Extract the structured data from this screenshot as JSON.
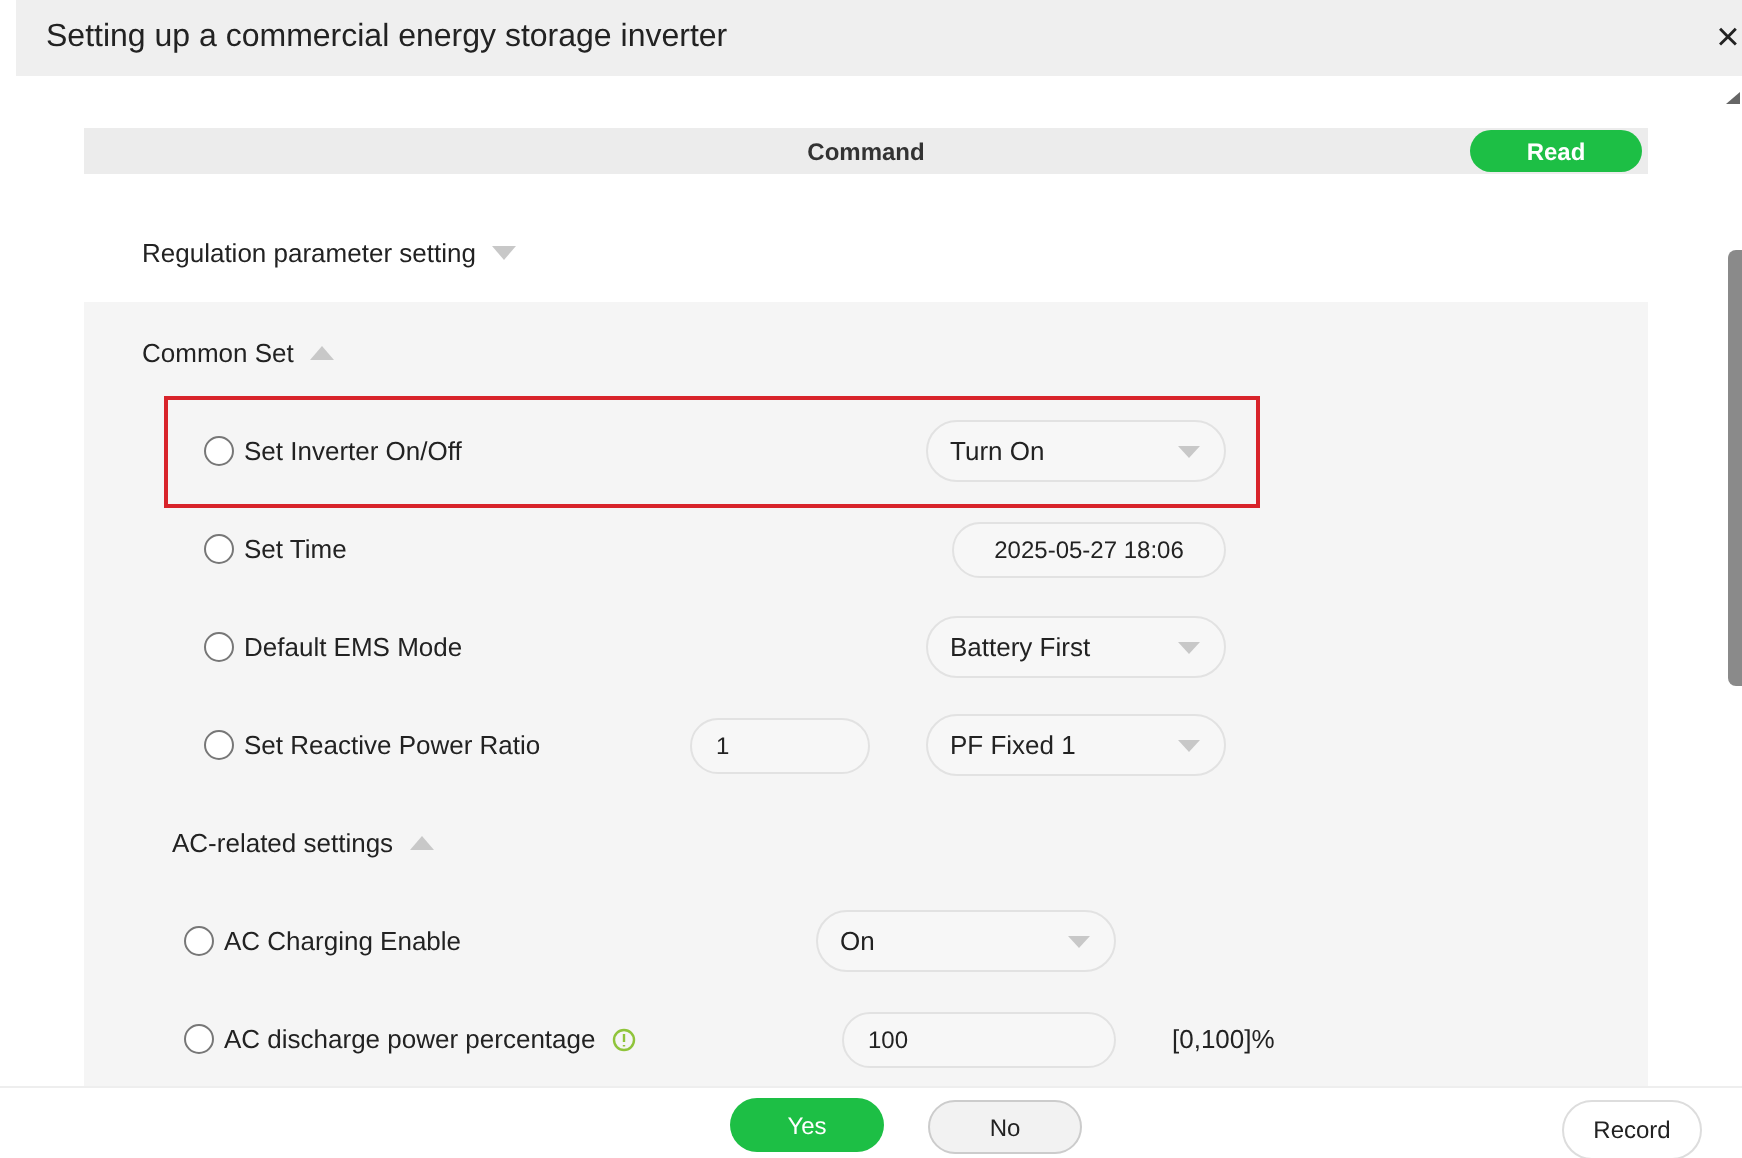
{
  "window": {
    "title": "Setting up a commercial energy storage inverter",
    "close": "×"
  },
  "command_bar": {
    "title": "Command",
    "read_button": "Read"
  },
  "sections": [
    {
      "title": "Regulation parameter setting",
      "expanded": false
    },
    {
      "title": "Common Set",
      "expanded": true,
      "items": [
        {
          "label": "Set Inverter On/Off",
          "checked": false,
          "highlighted": true,
          "controls": [
            {
              "kind": "select",
              "value": "Turn On"
            }
          ]
        },
        {
          "label": "Set Time",
          "checked": false,
          "highlighted": false,
          "controls": [
            {
              "kind": "datetime",
              "value": "2025-05-27 18:06"
            }
          ]
        },
        {
          "label": "Default EMS Mode",
          "checked": false,
          "highlighted": false,
          "controls": [
            {
              "kind": "select",
              "value": "Battery First"
            }
          ]
        },
        {
          "label": "Set Reactive Power Ratio",
          "checked": false,
          "highlighted": false,
          "controls": [
            {
              "kind": "input",
              "value": "1"
            },
            {
              "kind": "select",
              "value": "PF Fixed 1"
            }
          ]
        }
      ],
      "subsections": [
        {
          "title": "AC-related settings",
          "expanded": true,
          "items": [
            {
              "label": "AC Charging Enable",
              "checked": false,
              "highlighted": false,
              "info": false,
              "controls": [
                {
                  "kind": "select",
                  "value": "On"
                }
              ]
            },
            {
              "label": "AC discharge power percentage",
              "checked": false,
              "highlighted": false,
              "info": true,
              "range": "[0,100]%",
              "controls": [
                {
                  "kind": "input",
                  "value": "100"
                }
              ]
            }
          ]
        }
      ]
    }
  ],
  "footer": {
    "yes": "Yes",
    "no": "No",
    "record": "Record"
  }
}
